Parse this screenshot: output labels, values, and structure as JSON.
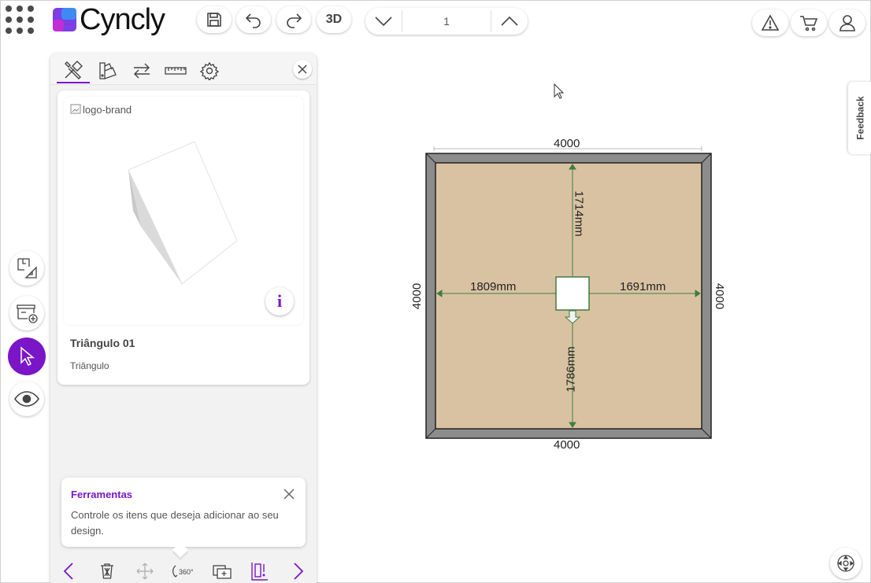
{
  "app": {
    "brand": "Cyncly",
    "btn_3d": "3D",
    "floor_value": "1"
  },
  "panel": {
    "tabs": [
      "tools-icon",
      "materials-icon",
      "swap-icon",
      "ruler-icon",
      "settings-icon"
    ],
    "item_image_alt": "logo-brand",
    "item_title": "Triângulo 01",
    "item_subtitle": "Triângulo",
    "info_label": "i",
    "tip": {
      "title": "Ferramentas",
      "text": "Controle os itens que deseja adicionar ao seu design."
    },
    "bottom_tools": [
      "prev-icon",
      "delete-icon",
      "move-icon",
      "rotate-360-icon",
      "duplicate-icon",
      "align-icon",
      "next-icon"
    ]
  },
  "canvas": {
    "room": {
      "width_label_top": "4000",
      "width_label_bottom": "4000",
      "height_label_left": "4000",
      "height_label_right": "4000",
      "dist_top": "1714mm",
      "dist_bottom": "1786mm",
      "dist_left": "1809mm",
      "dist_right": "1691mm"
    },
    "feedback_label": "Feedback"
  },
  "colors": {
    "accent": "#7a15c8",
    "floor": "#d9c2a2",
    "wall": "#8c8c8c",
    "dim_line": "#3e7d3e"
  }
}
